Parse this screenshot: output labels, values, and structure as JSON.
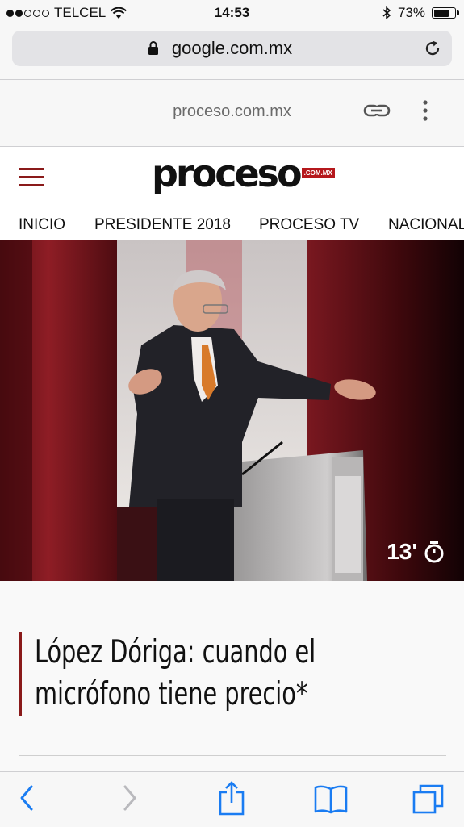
{
  "status": {
    "carrier": "TELCEL",
    "time": "14:53",
    "battery": "73%",
    "battery_level": 0.73,
    "signal_bars": 2
  },
  "browser": {
    "url": "google.com.mx"
  },
  "amp_bar": {
    "domain": "proceso.com.mx"
  },
  "site": {
    "logo_text": "proceso",
    "logo_badge": ".COM.MX",
    "accent": "#8a1a1a"
  },
  "nav": {
    "items": [
      "INICIO",
      "PRESIDENTE 2018",
      "PROCESO TV",
      "NACIONAL"
    ]
  },
  "hero": {
    "timer": "13'"
  },
  "article": {
    "title": "López Dóriga: cuando el micrófono tiene precio*"
  }
}
